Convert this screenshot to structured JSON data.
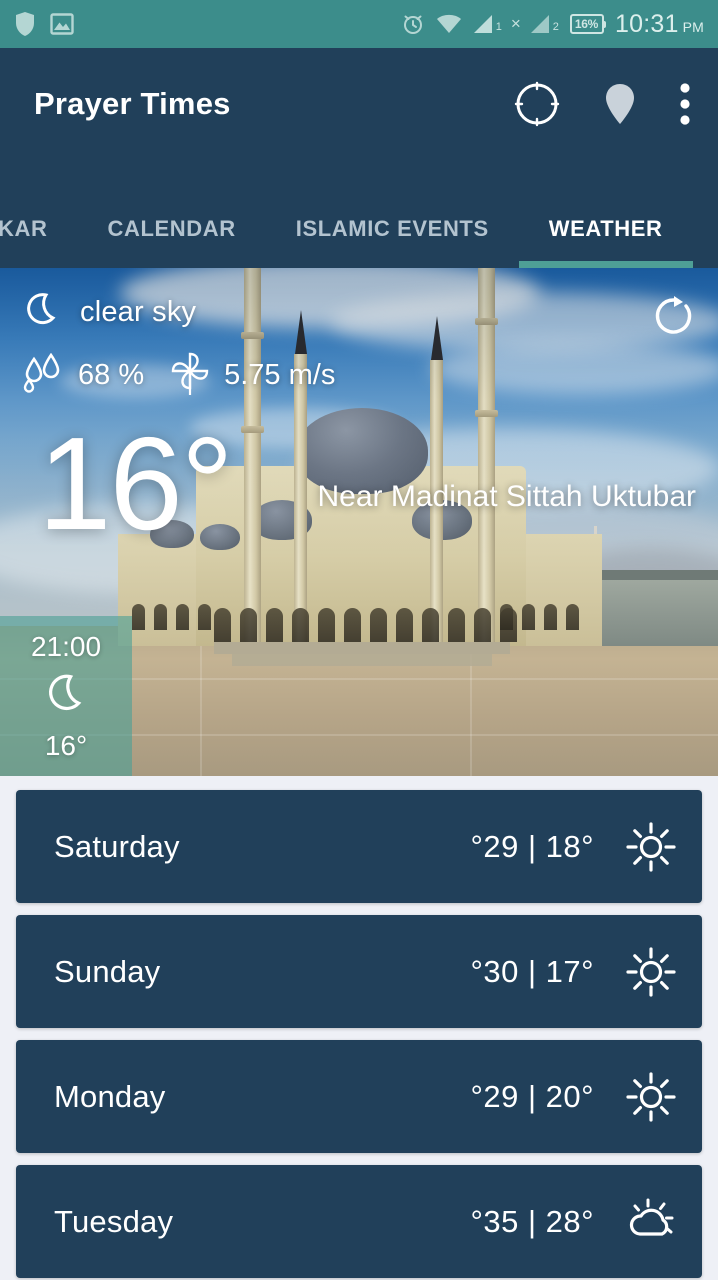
{
  "statusbar": {
    "left_icons": [
      "shield-icon",
      "photo-icon"
    ],
    "right_icons": [
      "alarm-icon",
      "wifi-icon",
      "signal-1-icon",
      "no-sim-x-icon",
      "signal-2-icon"
    ],
    "sim1_label": "1",
    "sim2_label": "2",
    "x_label": "×",
    "battery_label": "16%",
    "time": "10:31",
    "ampm": "PM",
    "bg_color": "#3c8d8b"
  },
  "toolbar": {
    "title": "Prayer Times",
    "actions": [
      {
        "name": "compass-icon"
      },
      {
        "name": "location-pin-icon"
      },
      {
        "name": "overflow-menu-icon"
      }
    ],
    "bg_color": "#21405a"
  },
  "tabs": {
    "items": [
      {
        "label": "ZKAR",
        "active": false
      },
      {
        "label": "CALENDAR",
        "active": false
      },
      {
        "label": "ISLAMIC EVENTS",
        "active": false
      },
      {
        "label": "WEATHER",
        "active": true
      }
    ],
    "active_index": 3,
    "indicator_color": "#4e9f96"
  },
  "hero": {
    "condition_icon": "crescent-moon-icon",
    "condition": "clear sky",
    "humidity_icon": "water-drops-icon",
    "humidity": "68 %",
    "wind_icon": "pinwheel-icon",
    "wind": "5.75 m/s",
    "refresh_icon": "refresh-icon",
    "temperature": "16°",
    "location": "Near Madinat Sittah Uktubar",
    "hourly": {
      "time": "21:00",
      "icon": "crescent-moon-icon",
      "temp": "16°",
      "overlay_color": "#4e9f96"
    }
  },
  "forecast": {
    "rows": [
      {
        "day": "Saturday",
        "temps": "°29 | 18°",
        "icon": "sun-icon"
      },
      {
        "day": "Sunday",
        "temps": "°30 | 17°",
        "icon": "sun-icon"
      },
      {
        "day": "Monday",
        "temps": "°29 | 20°",
        "icon": "sun-icon"
      },
      {
        "day": "Tuesday",
        "temps": "°35 | 28°",
        "icon": "sun-behind-cloud-icon"
      }
    ],
    "card_color": "#21405a",
    "page_bg": "#eef0f6"
  }
}
